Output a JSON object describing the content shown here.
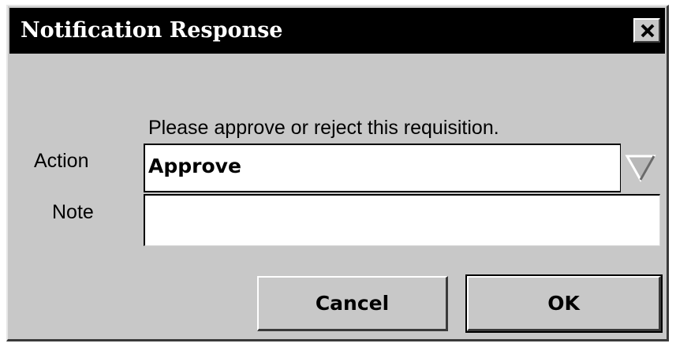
{
  "window": {
    "title": "Notification Response",
    "close_icon": "close-x-icon"
  },
  "form": {
    "instruction": "Please approve or reject this requisition.",
    "action_label": "Action",
    "action_value": "Approve",
    "action_dropdown_icon": "triangle-down-icon",
    "note_label": "Note",
    "note_value": ""
  },
  "buttons": {
    "cancel_label": "Cancel",
    "ok_label": "OK"
  },
  "colors": {
    "titlebar": "#000000",
    "dialog_bg": "#c8c8c8",
    "field_bg": "#ffffff"
  }
}
